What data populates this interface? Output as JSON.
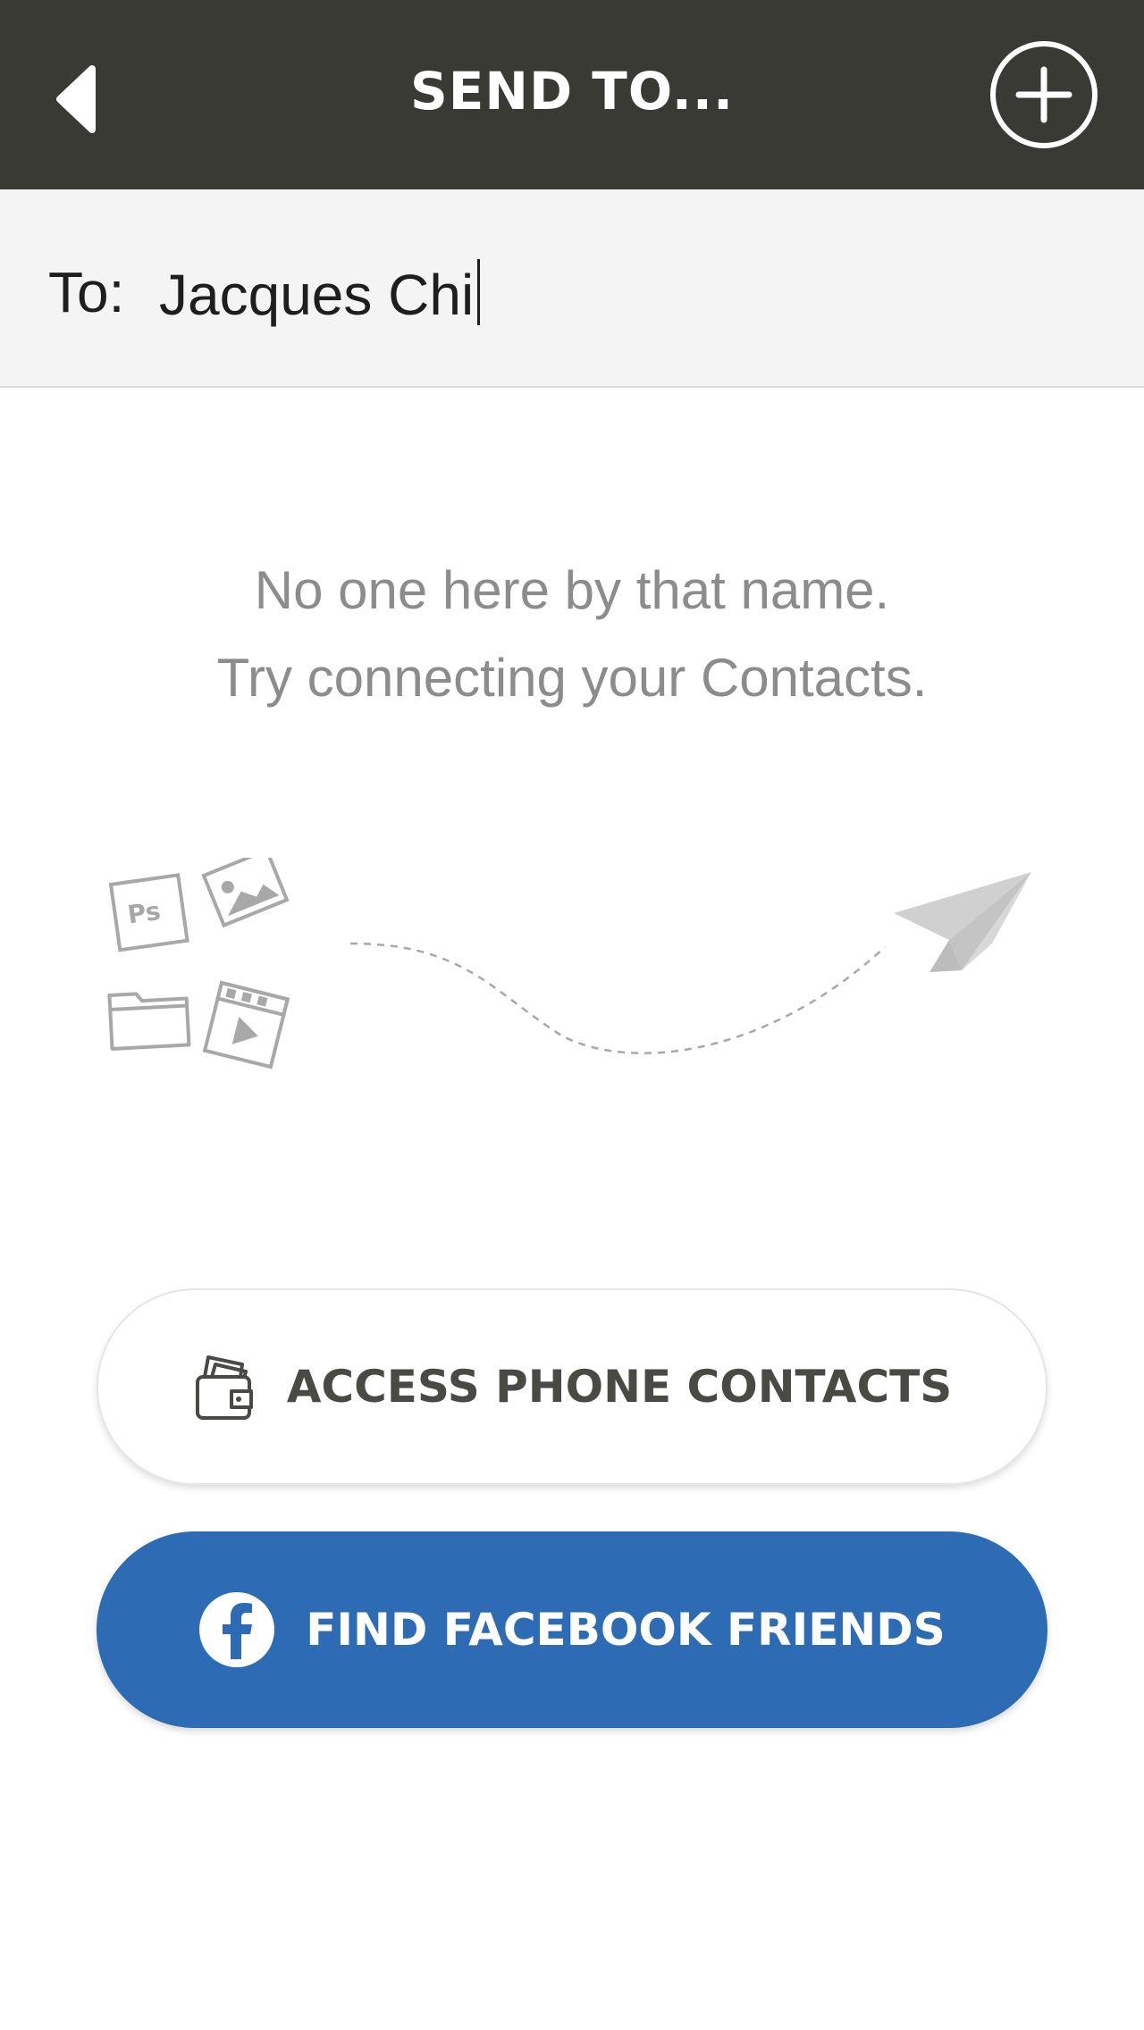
{
  "header": {
    "title": "SEND TO...",
    "back_icon": "back-arrow-icon",
    "add_icon": "plus-circle-icon",
    "background": "#3a3a34"
  },
  "recipient": {
    "label": "To:",
    "value": "Jacques Chi"
  },
  "empty_state": {
    "line1": "No one here by that name.",
    "line2": "Try connecting your Contacts."
  },
  "illustration": {
    "file_icon_text": "Ps",
    "icons": [
      "photoshop-file-icon",
      "image-file-icon",
      "folder-icon",
      "video-file-icon",
      "paper-plane-icon"
    ]
  },
  "actions": {
    "contacts_label": "ACCESS PHONE CONTACTS",
    "contacts_icon": "wallet-contacts-icon",
    "facebook_label": "FIND FACEBOOK FRIENDS",
    "facebook_icon": "facebook-icon",
    "facebook_color": "#2d6cb5"
  }
}
